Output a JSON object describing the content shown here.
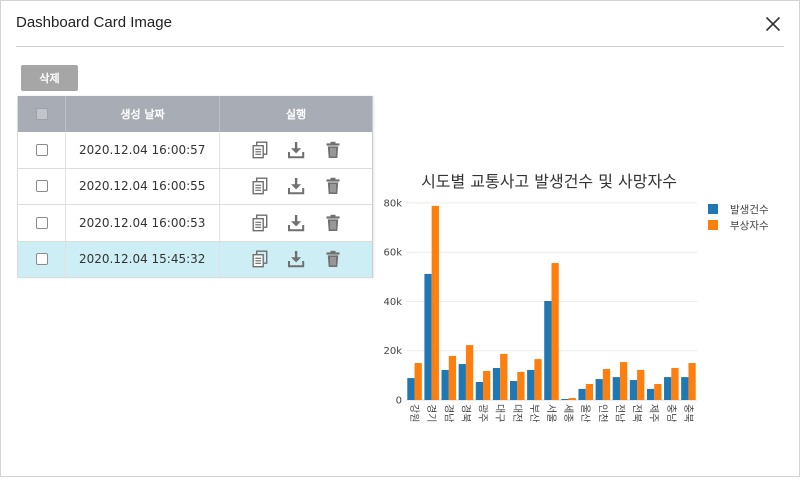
{
  "dialog": {
    "title": "Dashboard Card Image",
    "close_icon": "close-icon"
  },
  "toolbar": {
    "delete_label": "삭제"
  },
  "table": {
    "header_checkbox_checked": false,
    "columns": {
      "date": "생성 날짜",
      "actions": "실행"
    },
    "row_action_icons": [
      "copy-icon",
      "download-icon",
      "trash-icon"
    ],
    "rows": [
      {
        "checked": false,
        "date": "2020.12.04 16:00:57",
        "highlighted": false
      },
      {
        "checked": false,
        "date": "2020.12.04 16:00:55",
        "highlighted": false
      },
      {
        "checked": false,
        "date": "2020.12.04 16:00:53",
        "highlighted": false
      },
      {
        "checked": false,
        "date": "2020.12.04 15:45:32",
        "highlighted": true
      }
    ]
  },
  "colors": {
    "table_header": "#a7acb5",
    "row_highlight": "#cdeef4",
    "delete_button": "#a6a6a6",
    "icon": "#707070"
  },
  "chart_data": {
    "type": "bar",
    "title": "시도별 교통사고 발생건수 및 사망자수",
    "categories": [
      "강원",
      "경기",
      "경남",
      "경북",
      "광주",
      "대구",
      "대전",
      "부산",
      "서울",
      "세종",
      "울산",
      "인천",
      "전남",
      "전북",
      "제주",
      "충남",
      "충북"
    ],
    "series": [
      {
        "name": "발생건수",
        "color": "#1f77b4",
        "values": [
          8900,
          51200,
          12200,
          14600,
          7300,
          13000,
          7700,
          12200,
          40200,
          400,
          4500,
          8500,
          9300,
          8100,
          4500,
          9300,
          9300
        ]
      },
      {
        "name": "부상자수",
        "color": "#ff7f0e",
        "values": [
          15000,
          78800,
          17900,
          22300,
          11800,
          18700,
          11400,
          16600,
          55600,
          800,
          6500,
          12600,
          15400,
          12200,
          6500,
          13000,
          15000
        ]
      }
    ],
    "ylim": [
      0,
      82000
    ],
    "yticks": [
      0,
      20000,
      40000,
      60000,
      80000
    ],
    "ytick_labels": [
      "0",
      "20k",
      "40k",
      "60k",
      "80k"
    ],
    "grid": true,
    "legend": "top-right"
  }
}
